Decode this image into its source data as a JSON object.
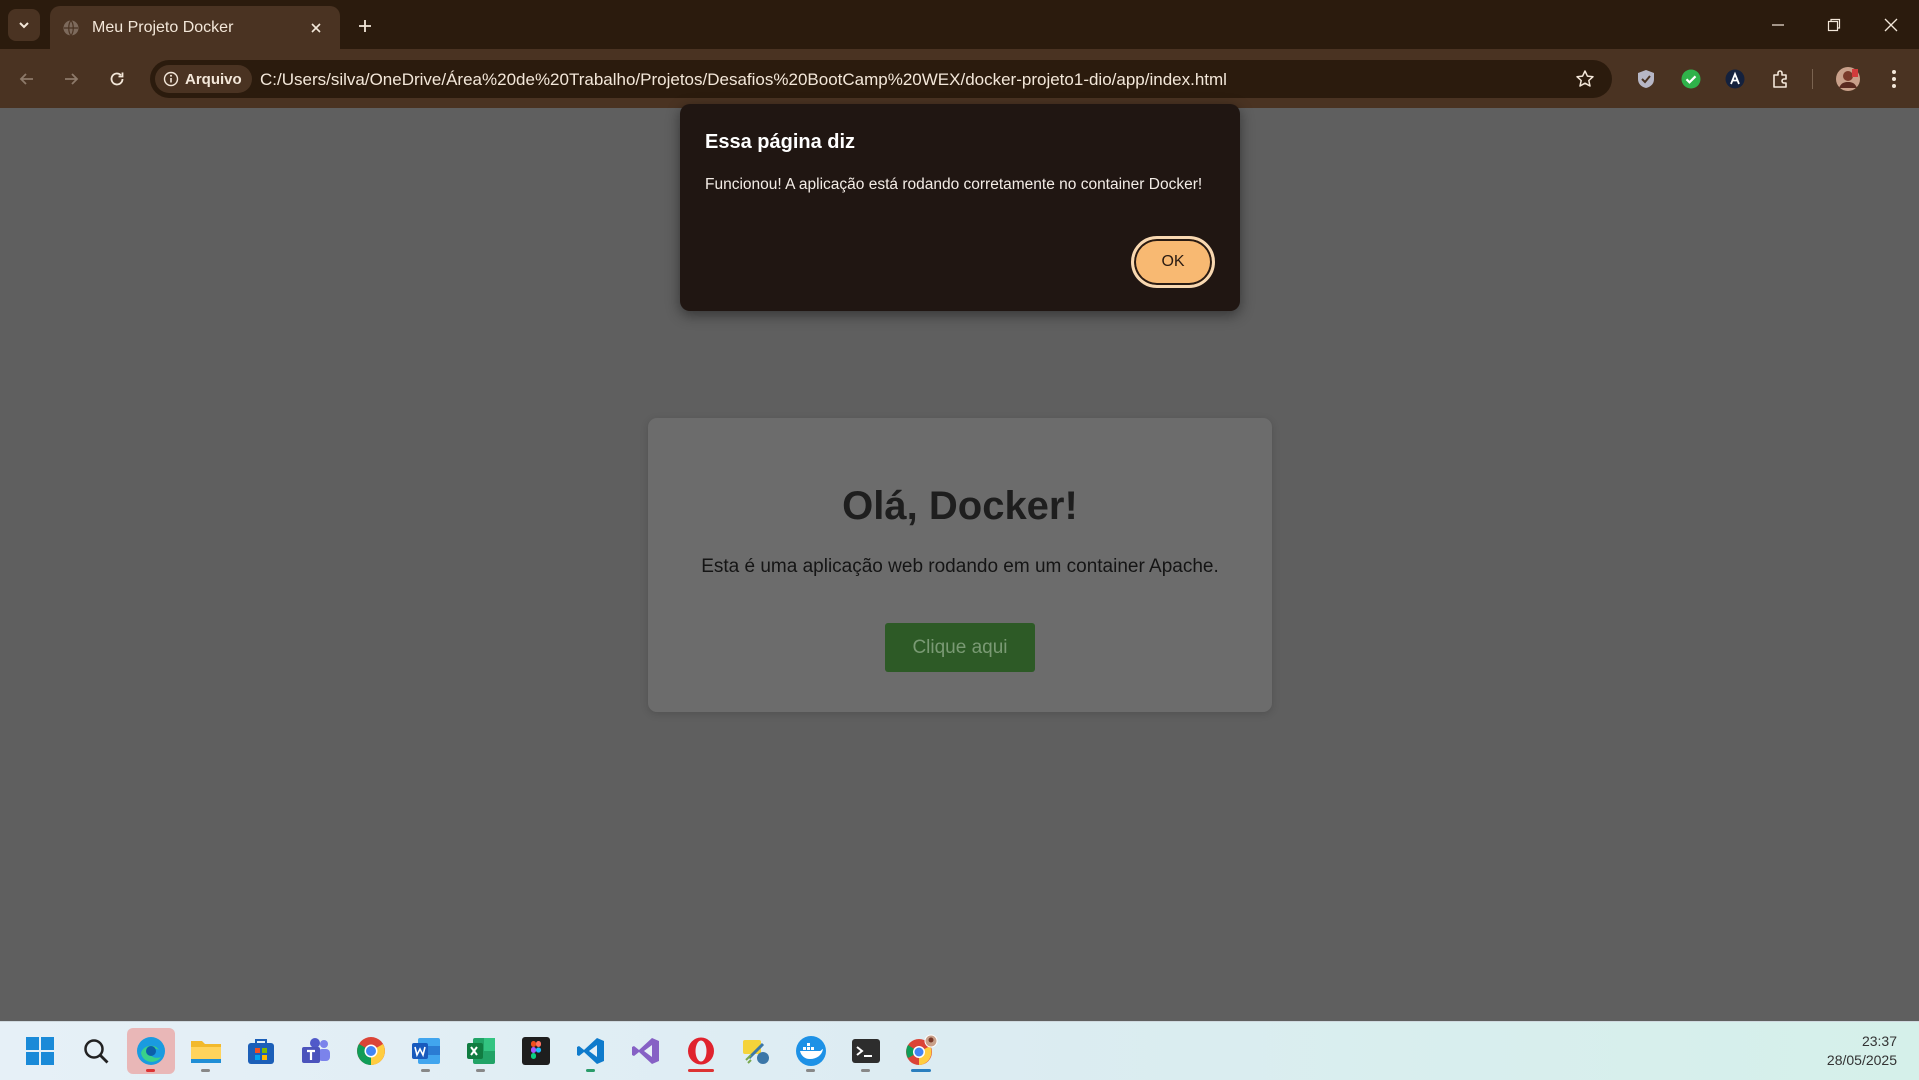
{
  "browser": {
    "tab": {
      "title": "Meu Projeto Docker"
    },
    "address": {
      "chip_label": "Arquivo",
      "url": "C:/Users/silva/OneDrive/Área%20de%20Trabalho/Projetos/Desafios%20BootCamp%20WEX/docker-projeto1-dio/app/index.html"
    }
  },
  "page": {
    "heading": "Olá, Docker!",
    "description": "Esta é uma aplicação web rodando em um container Apache.",
    "button_label": "Clique aqui"
  },
  "dialog": {
    "title": "Essa página diz",
    "message": "Funcionou! A aplicação está rodando corretamente no container Docker!",
    "ok_label": "OK"
  },
  "taskbar": {
    "apps": [
      "start",
      "search",
      "edge",
      "file-explorer",
      "microsoft-store",
      "teams",
      "chrome",
      "word",
      "excel",
      "figma",
      "vscode",
      "visual-studio",
      "opera",
      "python-idle",
      "docker",
      "terminal",
      "chrome-profile"
    ],
    "clock": {
      "time": "23:37",
      "date": "28/05/2025"
    }
  },
  "colors": {
    "chrome_dark": "#2b1b0d",
    "chrome_mid": "#4a3322",
    "page_overlay": "#5f5f5f",
    "dialog_bg": "#201612",
    "ok_button": "#f8b972",
    "page_button": "#2d5a26"
  }
}
